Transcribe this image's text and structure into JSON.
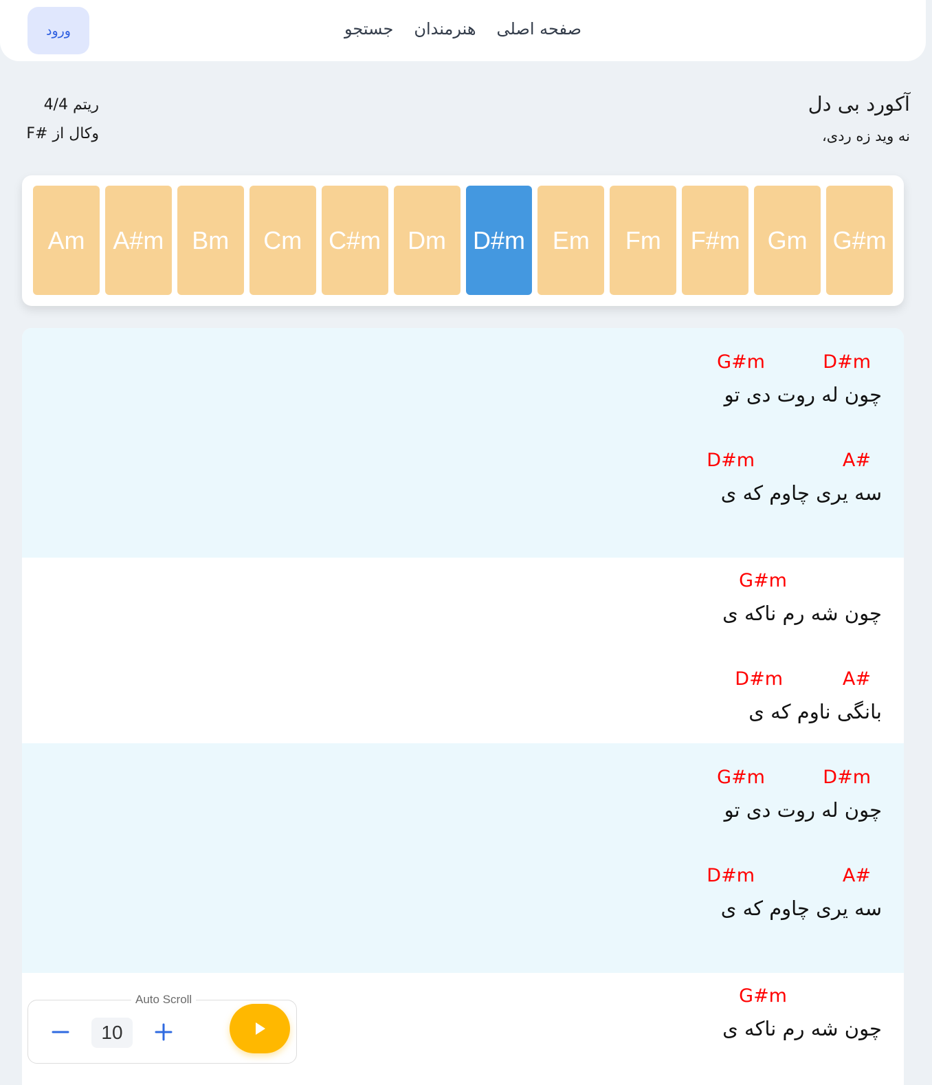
{
  "header": {
    "login_label": "ورود",
    "nav": [
      "صفحه اصلی",
      "هنرمندان",
      "جستجو"
    ]
  },
  "song": {
    "title": "آکورد بی دل",
    "artist": "نه وید زه ردی،",
    "rhythm": "ریتم 4/4",
    "vocal": "وکال از #F"
  },
  "keys": {
    "items": [
      "Am",
      "A#m",
      "Bm",
      "Cm",
      "C#m",
      "Dm",
      "D#m",
      "Em",
      "Fm",
      "F#m",
      "Gm",
      "G#m"
    ],
    "selected": "D#m"
  },
  "lyrics": [
    {
      "lines": [
        {
          "chords": [
            "D#m",
            "G#m"
          ],
          "text": "چون له روت دی تو"
        },
        {
          "chords": [
            "A#",
            "D#m"
          ],
          "text": "سه یری چاوم که ی"
        }
      ]
    },
    {
      "lines": [
        {
          "chords": [
            "G#m"
          ],
          "text": "چون شه رم ناکه ی"
        },
        {
          "chords": [
            "A#",
            "D#m"
          ],
          "text": "بانگی ناوم که ی"
        }
      ]
    },
    {
      "lines": [
        {
          "chords": [
            "D#m",
            "G#m"
          ],
          "text": "چون له روت دی تو"
        },
        {
          "chords": [
            "A#",
            "D#m"
          ],
          "text": "سه یری چاوم که ی"
        }
      ]
    },
    {
      "lines": [
        {
          "chords": [
            "G#m"
          ],
          "text": "چون شه رم ناکه ی"
        }
      ]
    }
  ],
  "autoscroll": {
    "label": "Auto Scroll",
    "speed": "10",
    "minus_icon": "minus-icon",
    "plus_icon": "plus-icon",
    "play_icon": "play-icon"
  },
  "colors": {
    "chord": "#ff0000",
    "key_default": "#f8d294",
    "key_selected": "#4498e0",
    "play_button": "#ffb800",
    "section_alt": "#ebf8fd"
  }
}
